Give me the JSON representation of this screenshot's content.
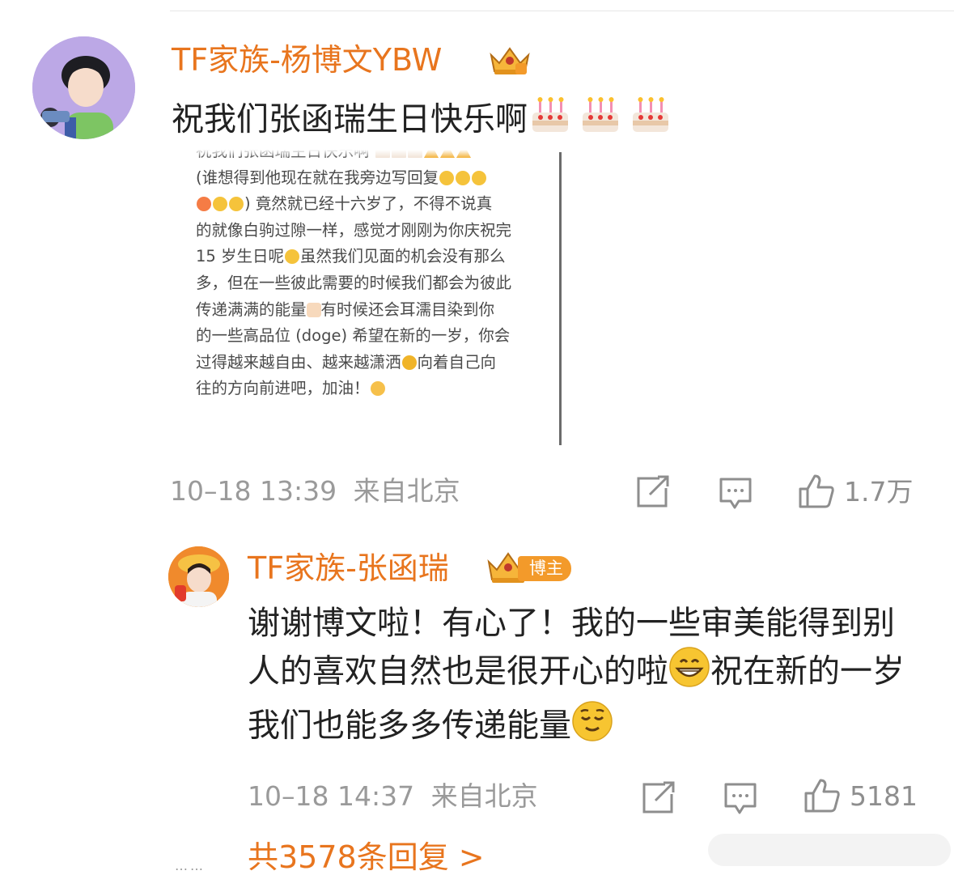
{
  "comment": {
    "username": "TF家族-杨博文YBW",
    "text": "祝我们张函瑞生日快乐啊",
    "quoted_post": {
      "line0": "祝我们张函瑞生日快乐啊",
      "line1": "(谁想得到他现在就在我旁边写回复",
      "line2": ") 竟然就已经十六岁了，不得不说真",
      "line3": "的就像白驹过隙一样，感觉才刚刚为你庆祝完",
      "line4a": "15 岁生日呢",
      "line4b": "虽然我们见面的机会没有那么",
      "line5": "多，但在一些彼此需要的时候我们都会为彼此",
      "line6a": "传递满满的能量",
      "line6b": "有时候还会耳濡目染到你",
      "line7": "的一些高品位 (doge) 希望在新的一岁，你会",
      "line8a": "过得越来越自由、越来越潇洒",
      "line8b": "向着自己向",
      "line9": "往的方向前进吧，加油！"
    },
    "time": "10–18 13:39",
    "location": "来自北京",
    "likes": "1.7万"
  },
  "reply": {
    "username": "TF家族-张函瑞",
    "badge": "博主",
    "text_part1": "谢谢博文啦！有心了！我的一些审美能得到别人的喜欢自然也是很开心的啦",
    "text_part2": "祝在新的一岁我们也能多多传递能量",
    "time": "10–18 14:37",
    "location": "来自北京",
    "likes": "5181"
  },
  "replies_summary": {
    "dots": "……",
    "label": "共3578条回复 >"
  },
  "icons": {
    "share": "share-icon",
    "comment": "comment-icon",
    "like": "thumbs-up-icon",
    "cake": "birthday-cake-emoji",
    "grin": "grinning-emoji",
    "relieved": "relieved-emoji"
  },
  "colors": {
    "username": "#e8751e",
    "text": "#222222",
    "meta": "#9a9a9a",
    "badge": "#f39a2a"
  }
}
